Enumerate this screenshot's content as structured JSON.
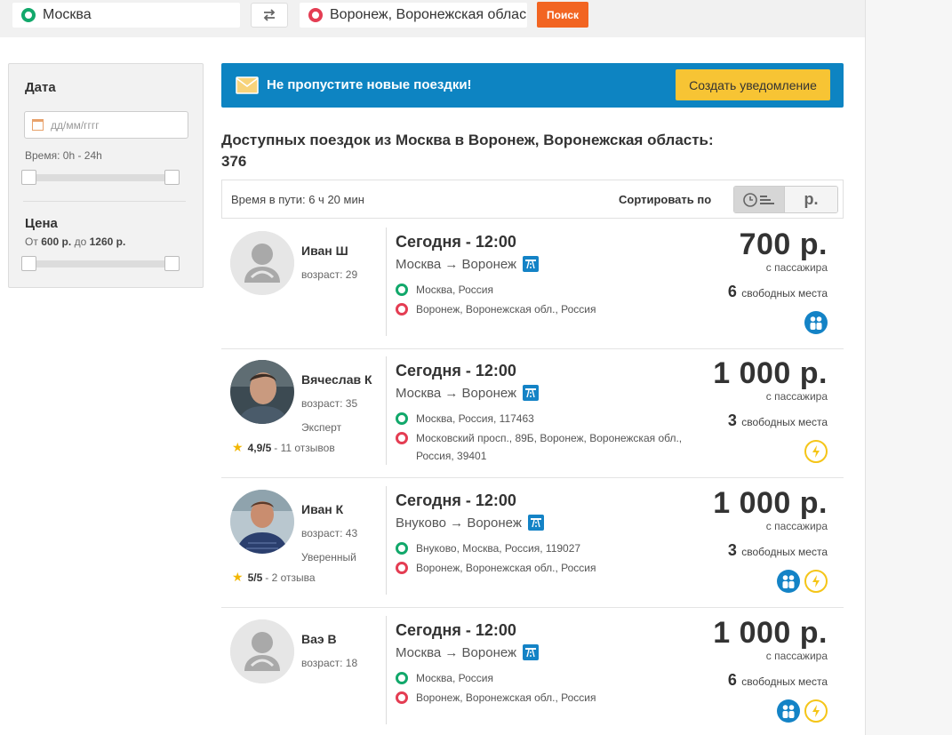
{
  "search": {
    "from": "Москва",
    "to": "Воронеж, Воронежская облас",
    "button": "Поиск"
  },
  "filters": {
    "date_title": "Дата",
    "date_placeholder": "дд/мм/гггг",
    "time_label": "Время: 0h - 24h",
    "price_title": "Цена",
    "price_from_label": "От",
    "price_min": "600 р.",
    "price_to_label": "до",
    "price_max": "1260 р."
  },
  "banner": {
    "text": "Не пропустите новые поездки!",
    "button": "Создать уведомление"
  },
  "results": {
    "heading": "Доступных поездок из Москва в Воронеж, Воронежская область:",
    "count": "376"
  },
  "sort": {
    "travel_time": "Время в пути: 6 ч 20 мин",
    "label": "Сортировать по",
    "price_option": "р."
  },
  "trips": [
    {
      "driver_name": "Иван Ш",
      "driver_age": "возраст: 29",
      "time": "Сегодня - 12:00",
      "route": "Москва → Воронеж",
      "from": "Москва, Россия",
      "to": "Воронеж, Воронежская обл., Россия",
      "price": "700 р.",
      "price_note": "с пассажира",
      "seats_count": "6",
      "seats_label": "свободных места",
      "avatar": "placeholder",
      "features": [
        "people-icon"
      ]
    },
    {
      "driver_name": "Вячеслав К",
      "driver_age": "возраст: 35",
      "driver_level": "Эксперт",
      "rating": "4,9/5",
      "reviews": "- 11 отзывов",
      "time": "Сегодня - 12:00",
      "route": "Москва → Воронеж",
      "from": "Москва, Россия, 117463",
      "to": "Московский просп., 89Б, Воронеж, Воронежская обл., Россия, 39401",
      "price": "1 000 р.",
      "price_note": "с пассажира",
      "seats_count": "3",
      "seats_label": "свободных места",
      "avatar": "photo",
      "features": [
        "lightning-icon"
      ]
    },
    {
      "driver_name": "Иван К",
      "driver_age": "возраст: 43",
      "driver_level": "Уверенный",
      "rating": "5/5",
      "reviews": "- 2 отзыва",
      "time": "Сегодня - 12:00",
      "route": "Внуково → Воронеж",
      "from": "Внуково, Москва, Россия, 119027",
      "to": "Воронеж, Воронежская обл., Россия",
      "price": "1 000 р.",
      "price_note": "с пассажира",
      "seats_count": "3",
      "seats_label": "свободных места",
      "avatar": "photo",
      "features": [
        "people-icon",
        "lightning-icon"
      ]
    },
    {
      "driver_name": "Ваэ В",
      "driver_age": "возраст: 18",
      "time": "Сегодня - 12:00",
      "route": "Москва → Воронеж",
      "from": "Москва, Россия",
      "to": "Воронеж, Воронежская обл., Россия",
      "price": "1 000 р.",
      "price_note": "с пассажира",
      "seats_count": "6",
      "seats_label": "свободных места",
      "avatar": "placeholder",
      "features": [
        "people-icon",
        "lightning-icon"
      ]
    }
  ],
  "colors": {
    "accent_orange": "#f26522",
    "banner_blue": "#0d84c2",
    "notify_yellow": "#f7c434",
    "origin_green": "#12a86b",
    "destination_red": "#e43d53"
  }
}
